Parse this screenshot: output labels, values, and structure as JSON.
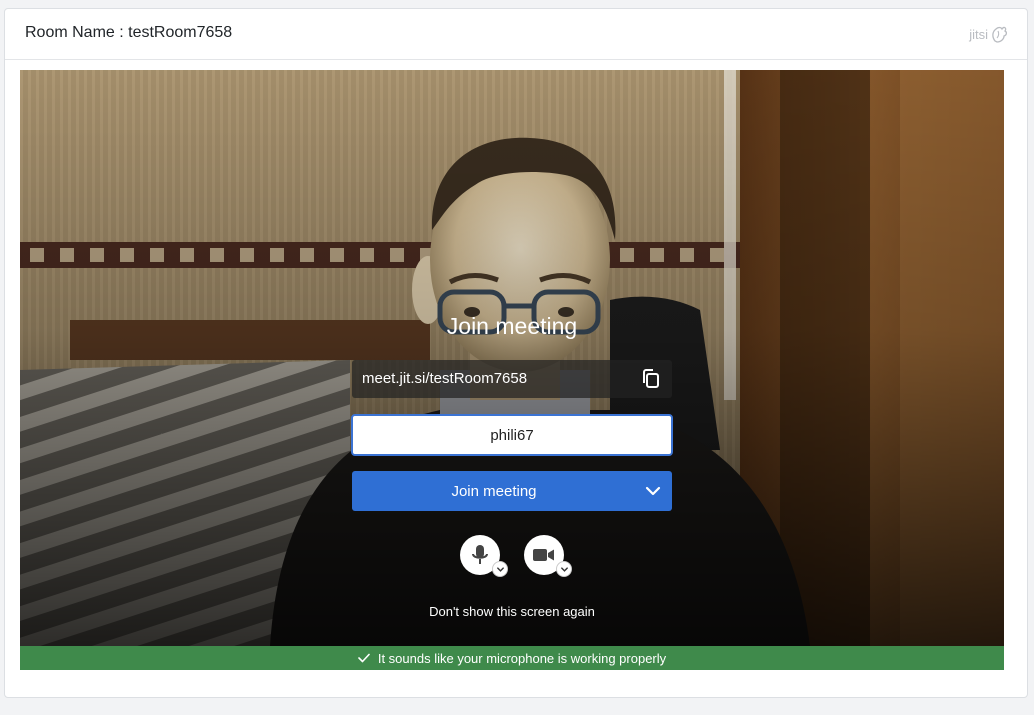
{
  "header": {
    "room_label": "Room Name : testRoom7658",
    "brand": "jitsi"
  },
  "prejoin": {
    "title": "Join meeting",
    "meeting_url": "meet.jit.si/testRoom7658",
    "name_value": "phili67",
    "join_button_label": "Join meeting",
    "dont_show_label": "Don't show this screen again"
  },
  "status": {
    "message": "It sounds like your microphone is working properly",
    "color": "#3f8a4b"
  },
  "colors": {
    "primary": "#2f6fd4",
    "input_border": "#3b73d3"
  },
  "icons": {
    "copy": "copy-icon",
    "chevron": "chevron-down-icon",
    "microphone": "microphone-icon",
    "camera": "camera-icon",
    "check": "checkmark-icon"
  }
}
